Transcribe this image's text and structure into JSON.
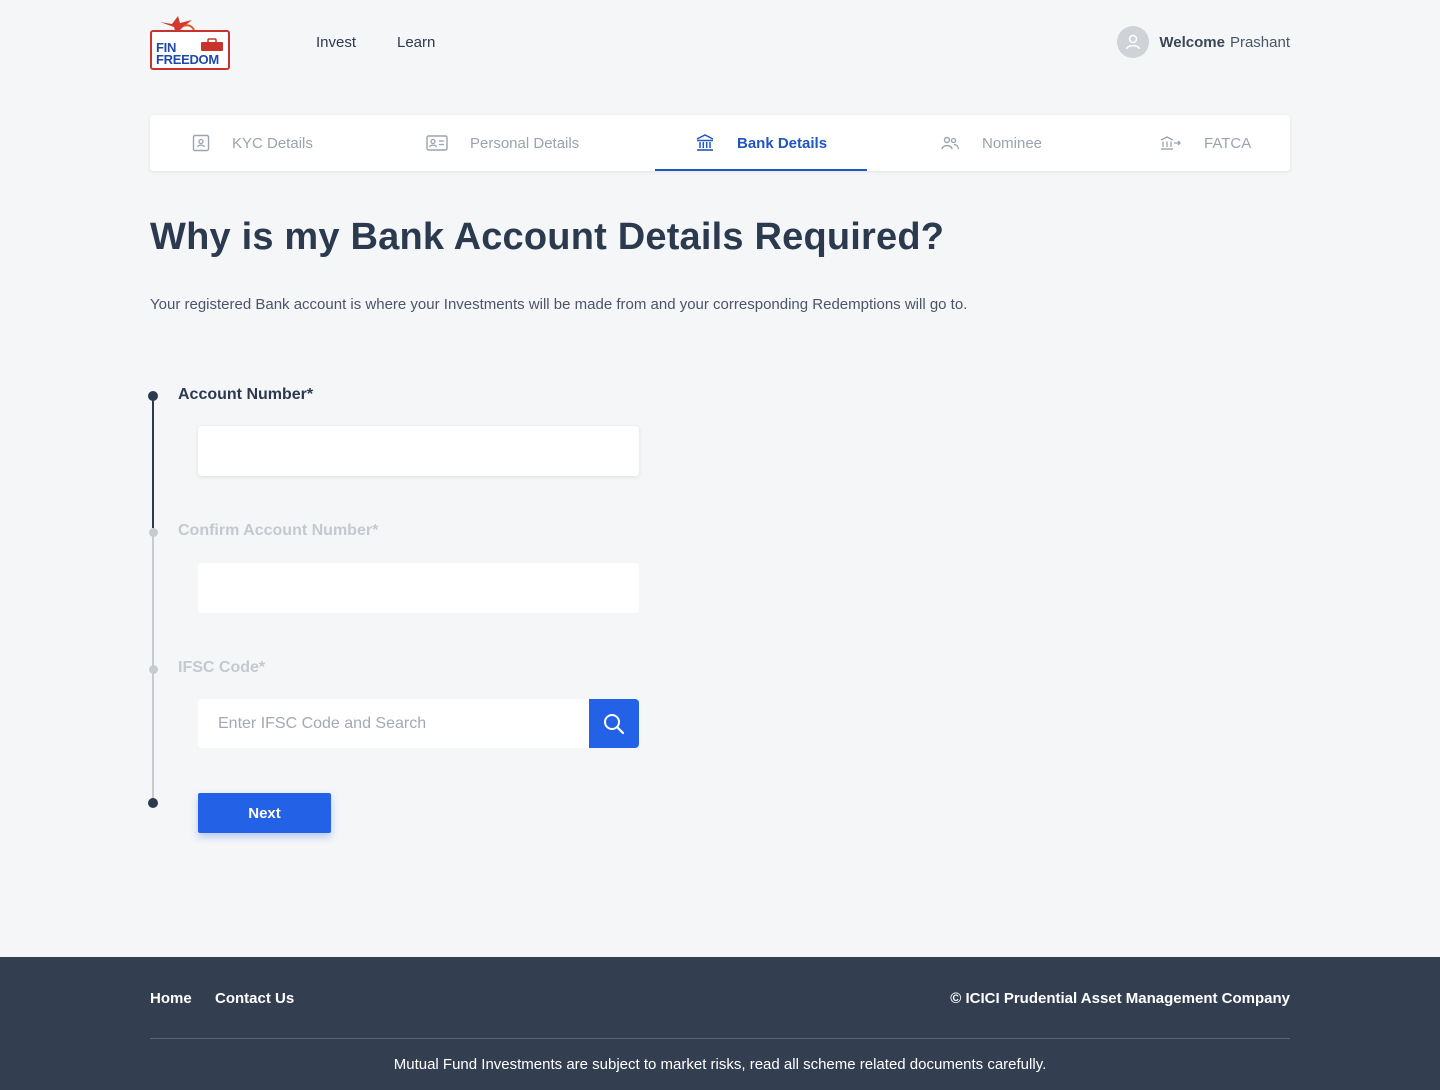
{
  "header": {
    "logo": {
      "line1": "FIN",
      "line2": "FREEDOM"
    },
    "nav": [
      {
        "label": "Invest"
      },
      {
        "label": "Learn"
      }
    ],
    "user": {
      "greeting": "Welcome",
      "name": "Prashant"
    }
  },
  "steps": [
    {
      "label": "KYC Details",
      "icon": "id-card-icon",
      "state": "inactive"
    },
    {
      "label": "Personal Details",
      "icon": "profile-card-icon",
      "state": "inactive"
    },
    {
      "label": "Bank Details",
      "icon": "bank-icon",
      "state": "active"
    },
    {
      "label": "Nominee",
      "icon": "people-icon",
      "state": "inactive"
    },
    {
      "label": "FATCA",
      "icon": "bank-transfer-icon",
      "state": "inactive"
    }
  ],
  "main": {
    "title": "Why is my Bank Account Details Required?",
    "subtitle": "Your registered Bank account is where your Investments will be made from and your corresponding Redemptions will go to.",
    "fields": {
      "account_number": {
        "label": "Account Number*",
        "value": ""
      },
      "confirm_account_number": {
        "label": "Confirm Account Number*",
        "value": ""
      },
      "ifsc": {
        "label": "IFSC Code*",
        "placeholder": "Enter IFSC Code and Search",
        "value": ""
      }
    },
    "next_label": "Next"
  },
  "footer": {
    "links": [
      {
        "label": "Home"
      },
      {
        "label": "Contact Us"
      }
    ],
    "copyright": "© ICICI Prudential Asset Management Company",
    "disclaimer": "Mutual Fund Investments are subject to market risks, read all scheme related documents carefully."
  },
  "colors": {
    "accent": "#2361e6",
    "active_tab": "#1f56c2",
    "footer_bg": "#333f51",
    "page_bg": "#f5f6f8",
    "text_dark": "#2c3a4f",
    "inactive": "#c4c9cf"
  }
}
